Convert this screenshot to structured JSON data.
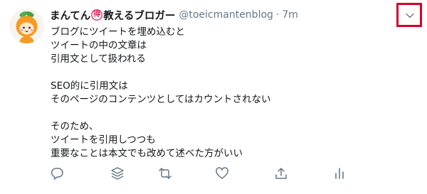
{
  "tweet": {
    "author": {
      "display_name": "まんてん",
      "badge_char": "得",
      "display_name_suffix": "教えるブロガー",
      "handle": "@toeicmantenblog",
      "separator": "·",
      "timestamp": "7m",
      "avatar_icon": "orange-character-avatar"
    },
    "menu_icon": "chevron-down-icon",
    "body_lines": [
      "ブログにツイートを埋め込むと",
      "ツイートの中の文章は",
      "引用文として扱われる",
      "",
      "SEO的に引用文は",
      "そのページのコンテンツとしてはカウントされない",
      "",
      "そのため、",
      "ツイートを引用しつつも",
      "重要なことは本文でも改めて述べた方がいい"
    ],
    "actions": [
      {
        "icon": "reply-icon"
      },
      {
        "icon": "thread-stack-icon"
      },
      {
        "icon": "retweet-icon"
      },
      {
        "icon": "like-icon"
      },
      {
        "icon": "share-icon"
      },
      {
        "icon": "analytics-icon"
      }
    ],
    "colors": {
      "text": "#14171a",
      "muted": "#657786",
      "badge": "#e0245e",
      "highlight_box": "#d6002a",
      "icon": "#657786"
    }
  }
}
